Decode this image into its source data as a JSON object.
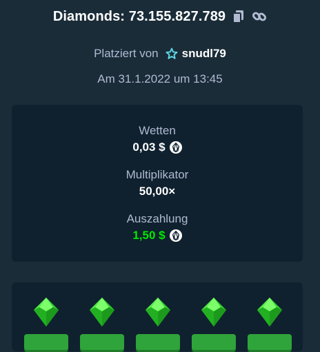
{
  "header": {
    "title": "Diamonds: 73.155.827.789",
    "copy_icon": "copy-icon",
    "link_icon": "link-icon"
  },
  "meta": {
    "placed_by_label": "Platziert von",
    "username": "snudl79",
    "date": "Am 31.1.2022 um 13:45"
  },
  "stats": {
    "bet": {
      "label": "Wetten",
      "value": "0,03 $"
    },
    "multiplier": {
      "label": "Multiplikator",
      "value": "50,00×"
    },
    "payout": {
      "label": "Auszahlung",
      "value": "1,50 $"
    }
  },
  "colors": {
    "background": "#1a2c38",
    "panel": "#0f212e",
    "muted_text": "#b1bad3",
    "payout_green": "#00e701",
    "gem_green": "#2fd02f",
    "star_cyan": "#5fd6e6"
  },
  "grid": {
    "visible_tiles": [
      "gem",
      "gem",
      "gem",
      "gem",
      "gem"
    ]
  }
}
